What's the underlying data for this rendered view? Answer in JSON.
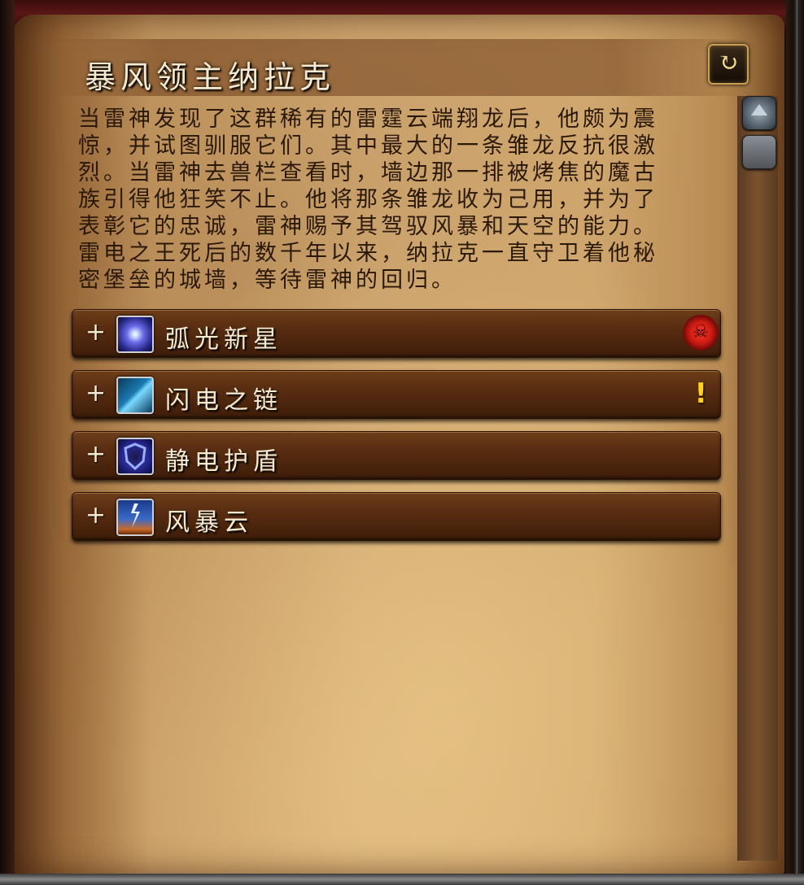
{
  "header": {
    "title": "暴风领主纳拉克"
  },
  "description": "当雷神发现了这群稀有的雷霆云端翔龙后，他颇为震\n惊，并试图驯服它们。其中最大的一条雏龙反抗很激\n烈。当雷神去兽栏查看时，墙边那一排被烤焦的魔古\n族引得他狂笑不止。他将那条雏龙收为己用，并为了\n表彰它的忠诚，雷神赐予其驾驭风暴和天空的能力。\n雷电之王死后的数千年以来，纳拉克一直守卫着他秘\n密堡垒的城墙，等待雷神的回归。",
  "abilities": [
    {
      "expand": "+",
      "label": "弧光新星",
      "icon": "arc-nova-icon",
      "flag": "deadly-skull-icon"
    },
    {
      "expand": "+",
      "label": "闪电之链",
      "icon": "chain-lightning-icon",
      "flag": "important-icon"
    },
    {
      "expand": "+",
      "label": "静电护盾",
      "icon": "static-shield-icon",
      "flag": ""
    },
    {
      "expand": "+",
      "label": "风暴云",
      "icon": "storm-cloud-icon",
      "flag": ""
    }
  ],
  "flags": {
    "important": "!",
    "deadly": "☠"
  },
  "colors": {
    "title_text": "#f4ead0",
    "body_text": "#2a1808",
    "row_bg": "#5a2e12",
    "warning": "#ffd21a",
    "deadly": "#c81a10"
  }
}
